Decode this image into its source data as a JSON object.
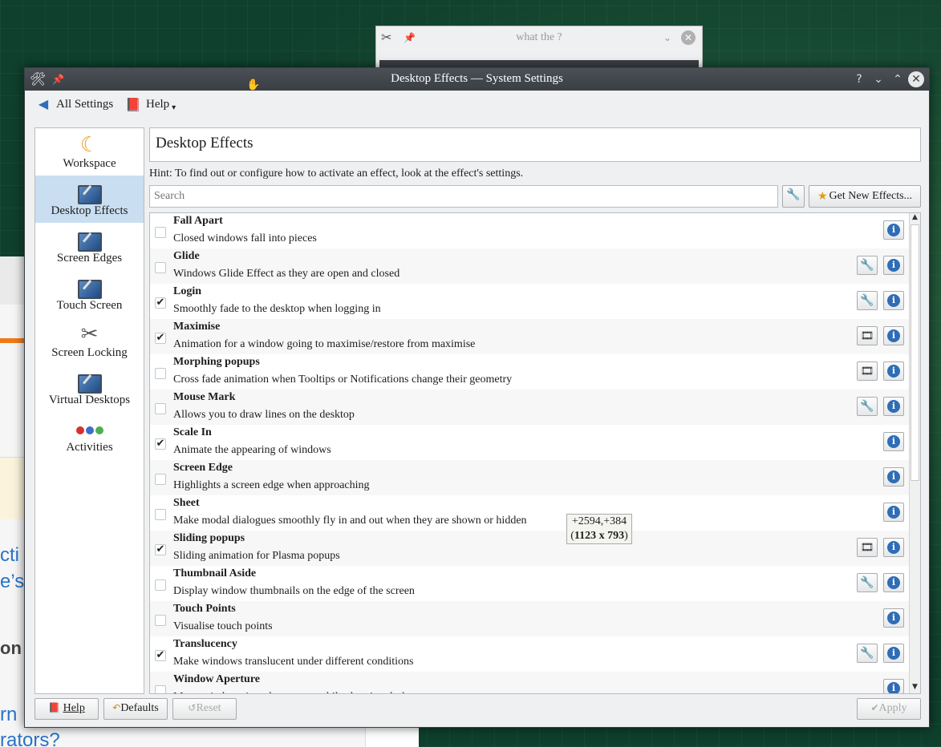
{
  "background": {
    "dialog_title": "what the ?",
    "page_fragments": [
      "cti",
      "e’s",
      "on",
      "rn",
      "rators?"
    ]
  },
  "window": {
    "title": "Desktop Effects — System Settings",
    "controls": [
      "help-icon",
      "minimize-icon",
      "maximize-icon",
      "close-icon"
    ]
  },
  "toolbar": {
    "back_label": "All Settings",
    "help_label": "Help"
  },
  "sidebar": {
    "items": [
      {
        "label": "Workspace",
        "icon": "workspace-icon",
        "selected": false
      },
      {
        "label": "Desktop Effects",
        "icon": "desktop-effects-icon",
        "selected": true
      },
      {
        "label": "Screen Edges",
        "icon": "screen-edges-icon",
        "selected": false
      },
      {
        "label": "Touch Screen",
        "icon": "touch-screen-icon",
        "selected": false
      },
      {
        "label": "Screen Locking",
        "icon": "screen-locking-icon",
        "selected": false
      },
      {
        "label": "Virtual Desktops",
        "icon": "virtual-desktops-icon",
        "selected": false
      },
      {
        "label": "Activities",
        "icon": "activities-icon",
        "selected": false
      }
    ]
  },
  "main": {
    "title": "Desktop Effects",
    "hint": "Hint: To find out or configure how to activate an effect, look at the effect's settings.",
    "search_placeholder": "Search",
    "get_new_label": "Get New Effects...",
    "effects": [
      {
        "name": "Fall Apart",
        "desc": "Closed windows fall into pieces",
        "checked": false,
        "config": "none"
      },
      {
        "name": "Glide",
        "desc": "Windows Glide Effect as they are open and closed",
        "checked": false,
        "config": "wrench-disabled"
      },
      {
        "name": "Login",
        "desc": "Smoothly fade to the desktop when logging in",
        "checked": true,
        "config": "wrench"
      },
      {
        "name": "Maximise",
        "desc": "Animation for a window going to maximise/restore from maximise",
        "checked": true,
        "config": "video"
      },
      {
        "name": "Morphing popups",
        "desc": "Cross fade animation when Tooltips or Notifications change their geometry",
        "checked": false,
        "config": "video"
      },
      {
        "name": "Mouse Mark",
        "desc": "Allows you to draw lines on the desktop",
        "checked": false,
        "config": "wrench-disabled"
      },
      {
        "name": "Scale In",
        "desc": "Animate the appearing of windows",
        "checked": true,
        "config": "none"
      },
      {
        "name": "Screen Edge",
        "desc": "Highlights a screen edge when approaching",
        "checked": false,
        "config": "none"
      },
      {
        "name": "Sheet",
        "desc": "Make modal dialogues smoothly fly in and out when they are shown or hidden",
        "checked": false,
        "config": "none"
      },
      {
        "name": "Sliding popups",
        "desc": "Sliding animation for Plasma popups",
        "checked": true,
        "config": "video"
      },
      {
        "name": "Thumbnail Aside",
        "desc": "Display window thumbnails on the edge of the screen",
        "checked": false,
        "config": "wrench-disabled"
      },
      {
        "name": "Touch Points",
        "desc": "Visualise touch points",
        "checked": false,
        "config": "none"
      },
      {
        "name": "Translucency",
        "desc": "Make windows translucent under different conditions",
        "checked": true,
        "config": "wrench"
      },
      {
        "name": "Window Aperture",
        "desc": "Move windows into the corners while showing desktop",
        "checked": false,
        "config": "none"
      }
    ]
  },
  "tooltip": {
    "position_text": "+2594,+384",
    "size_text": "1123 x 793"
  },
  "footer": {
    "help_label": "Help",
    "defaults_label": "Defaults",
    "reset_label": "Reset",
    "apply_label": "Apply"
  }
}
